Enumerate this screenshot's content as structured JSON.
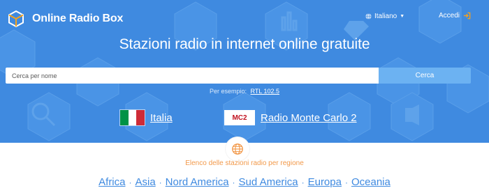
{
  "header": {
    "brand": "Online Radio Box",
    "language": "Italiano",
    "login": "Accedi"
  },
  "hero": {
    "headline": "Stazioni radio in internet online gratuite",
    "search_placeholder": "Cerca per nome",
    "search_button": "Cerca",
    "example_prefix": "Per esempio:",
    "example_link": "RTL 102.5",
    "country": "Italia",
    "station": "Radio Monte Carlo 2",
    "station_logo_text": "MC2"
  },
  "regions": {
    "caption": "Elenco delle stazioni radio per regione",
    "items": [
      "Africa",
      "Asia",
      "Nord America",
      "Sud America",
      "Europa",
      "Oceania"
    ],
    "separator": "·"
  },
  "colors": {
    "hero_blue": "#3f8ae0",
    "button_blue": "#6cb2f2",
    "caption_orange": "#f2994a",
    "flag_green": "#009246",
    "flag_white": "#ffffff",
    "flag_red": "#ce2b37"
  },
  "icons": {
    "logo": "cube-logo-icon",
    "language": "globe-icon",
    "login": "sign-in-icon",
    "regions": "globe-grid-icon"
  }
}
